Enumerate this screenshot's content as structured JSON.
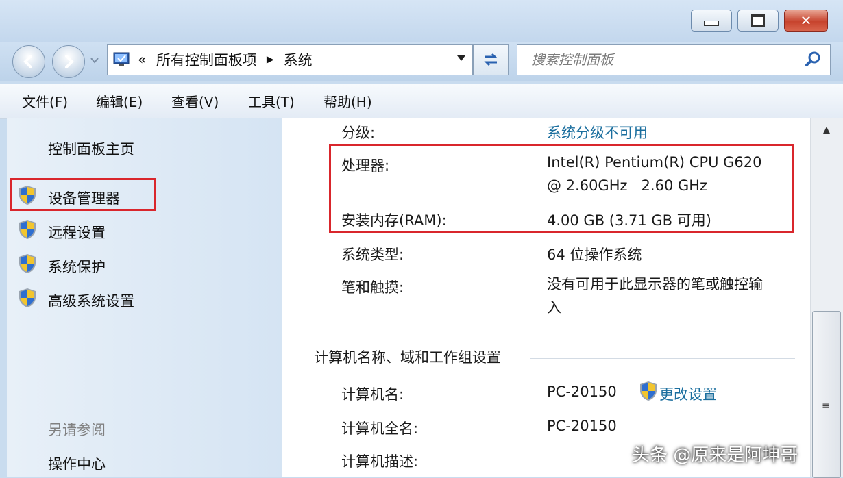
{
  "window": {
    "controls": {
      "minimize_icon": "minimize-icon",
      "maximize_icon": "maximize-icon",
      "close_label": "✕"
    }
  },
  "nav": {
    "address_breadcrumbs": [
      "«",
      "所有控制面板项",
      "系统"
    ],
    "search_placeholder": "搜索控制面板"
  },
  "menu": [
    "文件(F)",
    "编辑(E)",
    "查看(V)",
    "工具(T)",
    "帮助(H)"
  ],
  "sidebar": {
    "home": "控制面板主页",
    "links": [
      "设备管理器",
      "远程设置",
      "系统保护",
      "高级系统设置"
    ],
    "see_also_title": "另请参阅",
    "see_also": [
      "操作中心"
    ]
  },
  "system": {
    "rating_label": "分级:",
    "rating_value": "系统分级不可用",
    "processor_label": "处理器:",
    "processor_value_line1": "Intel(R) Pentium(R) CPU G620",
    "processor_value_line2": "@ 2.60GHz   2.60 GHz",
    "ram_label": "安装内存(RAM):",
    "ram_value": "4.00 GB (3.71 GB 可用)",
    "type_label": "系统类型:",
    "type_value": "64 位操作系统",
    "pen_label": "笔和触摸:",
    "pen_value_line1": "没有可用于此显示器的笔或触控输",
    "pen_value_line2": "入"
  },
  "computer": {
    "section_title": "计算机名称、域和工作组设置",
    "name_label": "计算机名:",
    "name_value": "PC-20150",
    "fullname_label": "计算机全名:",
    "fullname_value": "PC-20150",
    "desc_label": "计算机描述:",
    "change_settings": "更改设置"
  },
  "watermark": "头条 @原来是阿坤哥",
  "colors": {
    "highlight_box": "#d9262c",
    "link": "#1a6e9e"
  }
}
